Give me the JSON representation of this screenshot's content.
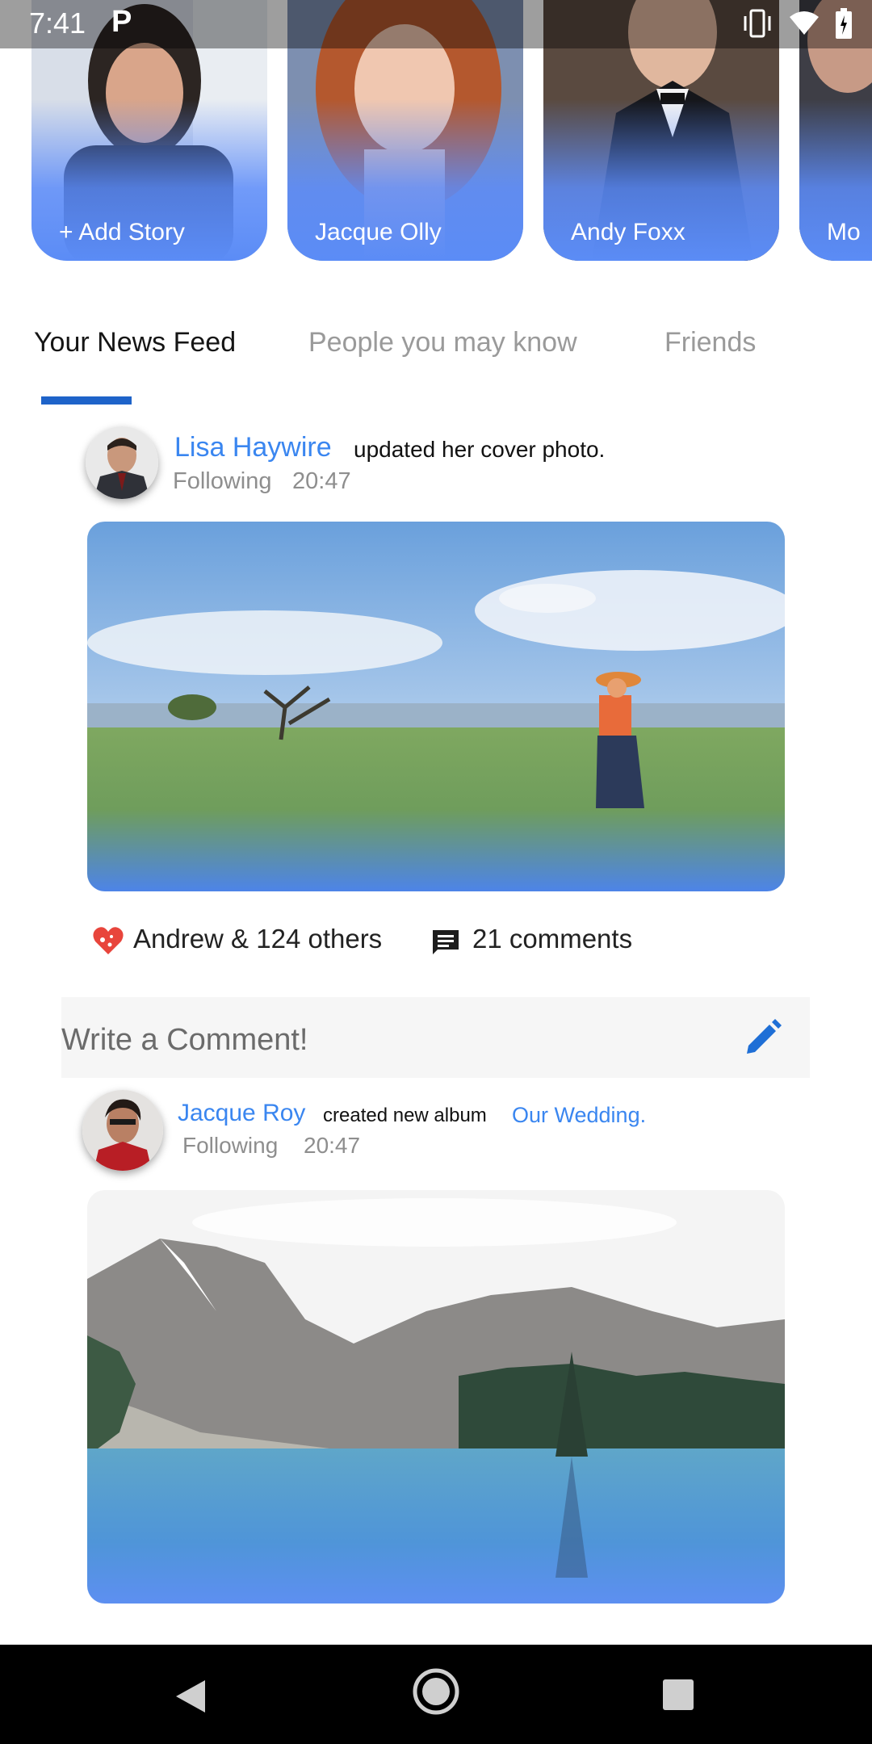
{
  "status_bar": {
    "time": "7:41",
    "notification": "P"
  },
  "stories": [
    {
      "label": "+ Add Story"
    },
    {
      "label": "Jacque Olly"
    },
    {
      "label": "Andy Foxx"
    },
    {
      "label": "Mo"
    }
  ],
  "tabs": [
    {
      "label": "Your News Feed"
    },
    {
      "label": "People you may know"
    },
    {
      "label": "Friends"
    }
  ],
  "posts": [
    {
      "user": "Lisa Haywire",
      "action": "updated her cover photo.",
      "relation": "Following",
      "time": "20:47",
      "likes_text": "Andrew & 124 others",
      "comments_text": "21 comments"
    },
    {
      "user": "Jacque Roy",
      "action": "created new album",
      "album": "Our Wedding.",
      "relation": "Following",
      "time": "20:47"
    }
  ],
  "comment_input": {
    "placeholder": "Write a Comment!"
  },
  "colors": {
    "accent": "#3a86f0",
    "tab_indicator": "#1e63c9",
    "story_fade": "#5b8cf6"
  }
}
